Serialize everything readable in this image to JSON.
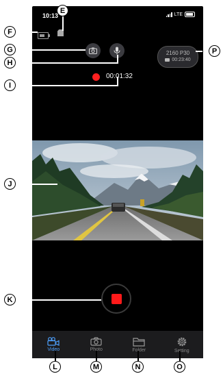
{
  "status_bar": {
    "time": "10:13",
    "network": "LTE"
  },
  "recording": {
    "elapsed": "00:01:32"
  },
  "resolution_badge": {
    "resolution": "2160 P30",
    "remaining": "00:23:40"
  },
  "tabs": [
    {
      "id": "video",
      "label": "Video",
      "icon": "video-camera-icon",
      "active": true
    },
    {
      "id": "photo",
      "label": "Photo",
      "icon": "camera-icon",
      "active": false
    },
    {
      "id": "folder",
      "label": "Folder",
      "icon": "folder-icon",
      "active": false
    },
    {
      "id": "setting",
      "label": "Setting",
      "icon": "gear-icon",
      "active": false
    }
  ],
  "callouts": {
    "E": "E",
    "F": "F",
    "G": "G",
    "H": "H",
    "I": "I",
    "J": "J",
    "K": "K",
    "L": "L",
    "M": "M",
    "N": "N",
    "O": "O",
    "P": "P"
  },
  "colors": {
    "accent": "#4ea1ff",
    "record": "#ff1a1a"
  }
}
